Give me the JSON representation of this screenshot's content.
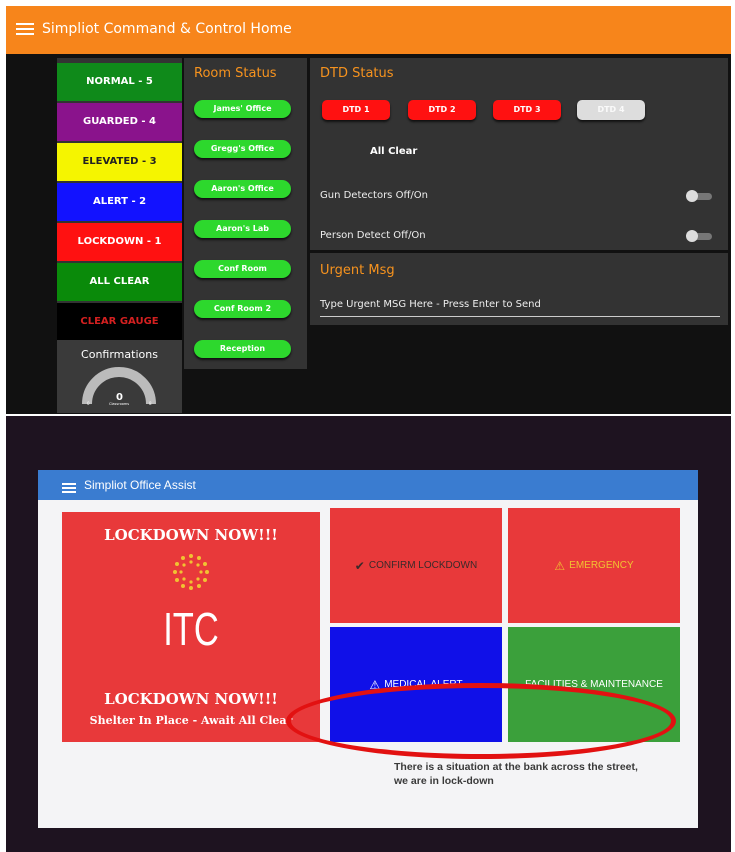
{
  "dashboard": {
    "title": "Simpliot Command & Control Home",
    "colors": {
      "header": "#f7851b",
      "panel": "#333333",
      "accent_title": "#f7931e"
    },
    "levels": [
      {
        "label": "NORMAL - 5",
        "color": "#0f8a1a"
      },
      {
        "label": "GUARDED - 4",
        "color": "#8a138c"
      },
      {
        "label": "ELEVATED - 3",
        "color": "#f5f500"
      },
      {
        "label": "ALERT - 2",
        "color": "#1212ff"
      },
      {
        "label": "LOCKDOWN - 1",
        "color": "#ff1111"
      },
      {
        "label": "ALL CLEAR",
        "color": "#0a8a0a"
      },
      {
        "label": "CLEAR GAUGE",
        "color": "#000000"
      }
    ],
    "confirmations": {
      "label": "Confirmations",
      "value": "0",
      "min": "0",
      "max": "8",
      "caption": "Classrooms"
    },
    "room_status": {
      "title": "Room Status",
      "rooms": [
        "James' Office",
        "Gregg's Office",
        "Aaron's Office",
        "Aaron's Lab",
        "Conf Room",
        "Conf Room 2",
        "Reception"
      ]
    },
    "dtd_status": {
      "title": "DTD Status",
      "buttons": [
        {
          "label": "DTD 1",
          "color": "#ff1111"
        },
        {
          "label": "DTD 2",
          "color": "#ff1111"
        },
        {
          "label": "DTD 3",
          "color": "#ff1111"
        },
        {
          "label": "DTD 4",
          "color": "#dddddd"
        }
      ],
      "status": "All Clear",
      "toggles": [
        {
          "label": "Gun Detectors Off/On",
          "on": false
        },
        {
          "label": "Person Detect Off/On",
          "on": false
        }
      ]
    },
    "urgent": {
      "title": "Urgent Msg",
      "placeholder": "Type Urgent MSG Here - Press Enter to Send"
    }
  },
  "tablet": {
    "title": "Simpliot Office Assist",
    "colors": {
      "header": "#3a7cd0",
      "lock": "#e8393a"
    },
    "lockdown": {
      "heading": "LOCKDOWN NOW!!!",
      "logo_text": "ITC",
      "heading2": "LOCKDOWN NOW!!!",
      "subtext": "Shelter In Place - Await All Clear"
    },
    "tiles": [
      {
        "label": "CONFIRM LOCKDOWN",
        "icon": "check-icon",
        "color": "#e8393a"
      },
      {
        "label": "EMERGENCY",
        "icon": "warning-icon",
        "color": "#e8393a"
      },
      {
        "label": "MEDICAL ALERT",
        "icon": "warning-icon",
        "color": "#1010e8"
      },
      {
        "label": "FACILITIES & MAINTENANCE",
        "icon": "",
        "color": "#3ba03b"
      }
    ],
    "message": "There is a situation at the bank across the street, we are in lock-down"
  }
}
